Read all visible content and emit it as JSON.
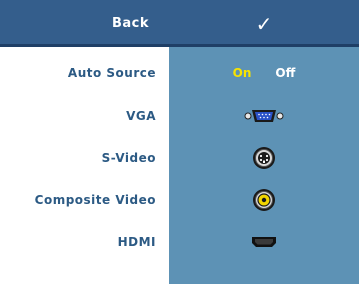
{
  "header": {
    "back_label": "Back",
    "confirm_glyph": "✓"
  },
  "menu": {
    "auto_source": {
      "label": "Auto Source",
      "on_label": "On",
      "off_label": "Off",
      "selected": "On"
    },
    "items": [
      {
        "label": "VGA",
        "icon": "vga-connector-icon"
      },
      {
        "label": "S-Video",
        "icon": "s-video-connector-icon"
      },
      {
        "label": "Composite Video",
        "icon": "composite-video-connector-icon"
      },
      {
        "label": "HDMI",
        "icon": "hdmi-connector-icon"
      }
    ]
  },
  "colors": {
    "header_bg": "#345e8c",
    "panel_bg": "#5d92b5",
    "label_text": "#2c5a84",
    "selected_option": "#f7e300"
  }
}
